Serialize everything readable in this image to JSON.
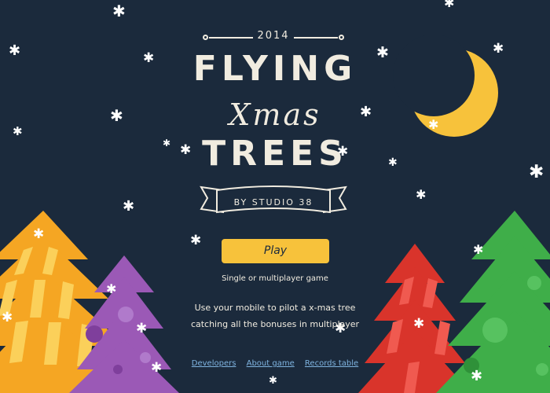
{
  "header": {
    "year": "2014"
  },
  "title": {
    "line1": "FLYING",
    "line2": "Xmas",
    "line3": "TREES",
    "studio": "BY STUDIO 38"
  },
  "play": {
    "label": "Play",
    "subtitle": "Single or multiplayer game"
  },
  "description": {
    "line1": "Use your mobile to pilot a x-mas tree",
    "line2": "catching all the bonuses in multiplayer"
  },
  "footer": {
    "links": [
      "Developers",
      "About game",
      "Records table"
    ]
  },
  "colors": {
    "background": "#1b2a3c",
    "text": "#f1ece0",
    "accent": "#f7c23b",
    "link": "#7fb4e0",
    "tree_orange": "#f5a623",
    "tree_purple": "#9b59b6",
    "tree_red": "#d9342b",
    "tree_green": "#3fae49"
  },
  "icons": [
    "snowflake-icon",
    "crescent-moon-icon"
  ]
}
